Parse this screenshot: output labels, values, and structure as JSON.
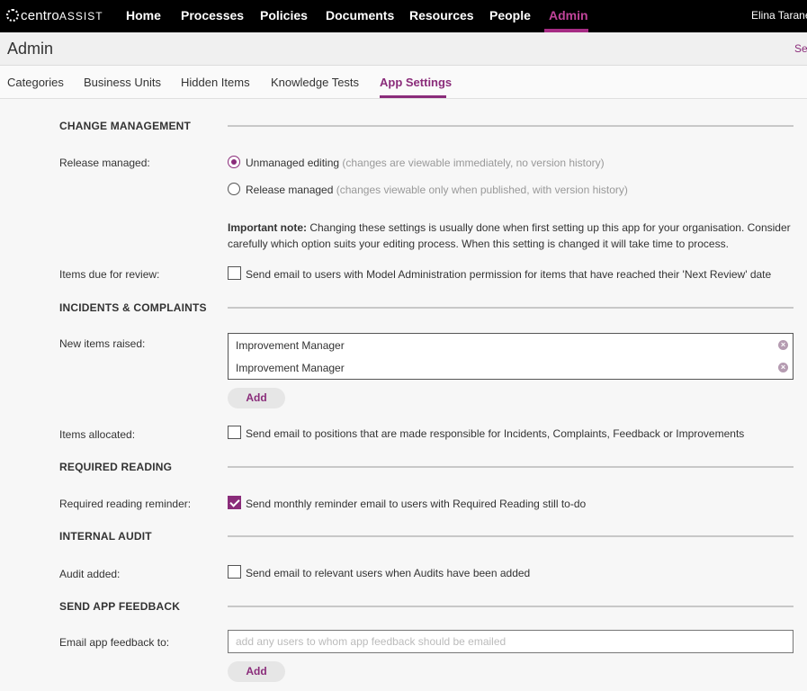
{
  "brand": {
    "logo_part1": "centro",
    "logo_part2": "ASSIST",
    "accent": "#8a2c7a"
  },
  "nav": {
    "items": [
      {
        "label": "Home"
      },
      {
        "label": "Processes"
      },
      {
        "label": "Policies"
      },
      {
        "label": "Documents"
      },
      {
        "label": "Resources"
      },
      {
        "label": "People"
      },
      {
        "label": "Admin"
      }
    ],
    "active": "Admin",
    "user": "Elina Tarane"
  },
  "page": {
    "title": "Admin",
    "search_link": "Se"
  },
  "subtabs": {
    "items": [
      {
        "label": "Categories"
      },
      {
        "label": "Business Units"
      },
      {
        "label": "Hidden Items"
      },
      {
        "label": "Knowledge Tests"
      },
      {
        "label": "App Settings"
      }
    ],
    "active": "App Settings"
  },
  "sections": {
    "change_management": {
      "title": "CHANGE MANAGEMENT",
      "release_label": "Release managed:",
      "option_unmanaged": {
        "label": "Unmanaged editing",
        "hint": "(changes are viewable immediately, no version history)",
        "checked": true
      },
      "option_managed": {
        "label": "Release managed",
        "hint": "(changes viewable only when published, with version history)",
        "checked": false
      },
      "note_bold": "Important note:",
      "note_text": "Changing these settings is usually done when first setting up this app for your organisation. Consider carefully which option suits your editing process. When this setting is changed it will take time to process.",
      "review_label": "Items due for review:",
      "review_checkbox": "Send email to users with Model Administration permission for items that have reached their 'Next Review' date"
    },
    "incidents": {
      "title": "INCIDENTS & COMPLAINTS",
      "new_items_label": "New items raised:",
      "recipients": [
        "Improvement Manager",
        "Improvement Manager"
      ],
      "add_label": "Add",
      "allocated_label": "Items allocated:",
      "allocated_checkbox": "Send email to positions that are made responsible for Incidents, Complaints, Feedback or Improvements"
    },
    "required_reading": {
      "title": "REQUIRED READING",
      "reminder_label": "Required reading reminder:",
      "reminder_checkbox": "Send monthly reminder email to users with Required Reading still to-do",
      "checked": true
    },
    "internal_audit": {
      "title": "INTERNAL AUDIT",
      "audit_label": "Audit added:",
      "audit_checkbox": "Send email to relevant users when Audits have been added"
    },
    "feedback": {
      "title": "SEND APP FEEDBACK",
      "email_label": "Email app feedback to:",
      "email_placeholder": "add any users to whom app feedback should be emailed",
      "email_value": "",
      "add_label": "Add"
    }
  }
}
